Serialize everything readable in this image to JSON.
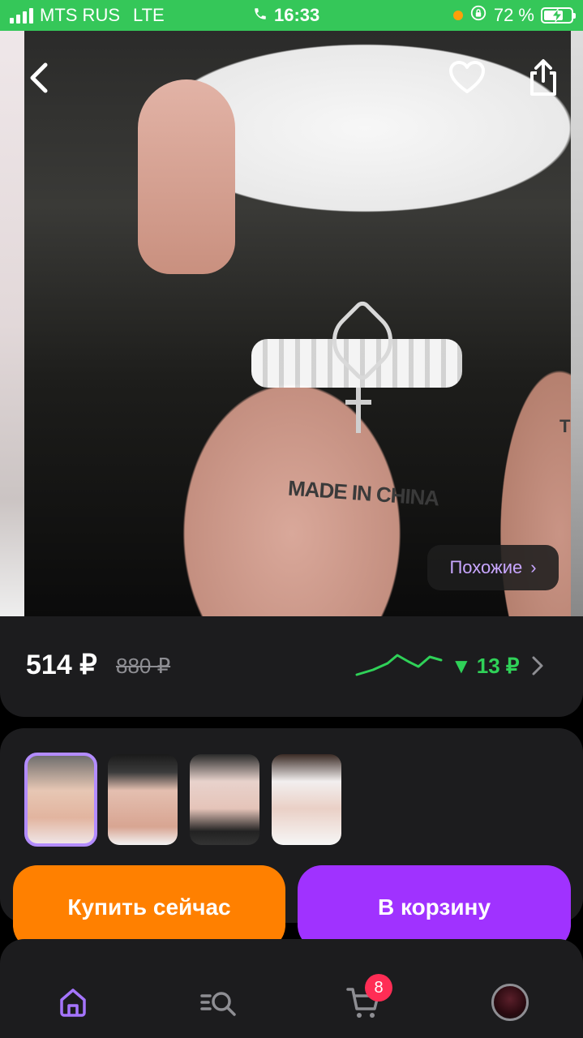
{
  "status_bar": {
    "carrier": "MTS RUS",
    "network": "LTE",
    "time": "16:33",
    "battery_percent": "72 %",
    "battery_level": 0.72
  },
  "top_bar": {
    "back_icon": "chevron-left-icon",
    "favorite_icon": "heart-outline-icon",
    "share_icon": "share-icon"
  },
  "photo": {
    "tattoo_text": "MADE IN CHINA",
    "tattoo_text_2": "THA",
    "similar_label": "Похожие",
    "similar_chevron": "›"
  },
  "price": {
    "current": "514 ₽",
    "old": "880 ₽",
    "drop_arrow": "▼",
    "drop_amount": "13 ₽",
    "trend_color": "#2fd158",
    "chevron": "›"
  },
  "variants": {
    "items": [
      {
        "name": "variant-1",
        "selected": true
      },
      {
        "name": "variant-2",
        "selected": false
      },
      {
        "name": "variant-3",
        "selected": false
      },
      {
        "name": "variant-4",
        "selected": false
      }
    ],
    "selected_border_color": "#b38cff"
  },
  "actions": {
    "buy_now": "Купить сейчас",
    "add_to_cart": "В корзину",
    "buy_color": "#ff8000",
    "cart_color": "#a032ff"
  },
  "bottom_nav": {
    "items": [
      {
        "icon": "home-icon",
        "active": true
      },
      {
        "icon": "catalog-search-icon",
        "active": false
      },
      {
        "icon": "cart-icon",
        "active": false
      },
      {
        "icon": "profile-avatar",
        "active": false
      }
    ],
    "cart_badge": "8",
    "active_color": "#a575ff"
  }
}
